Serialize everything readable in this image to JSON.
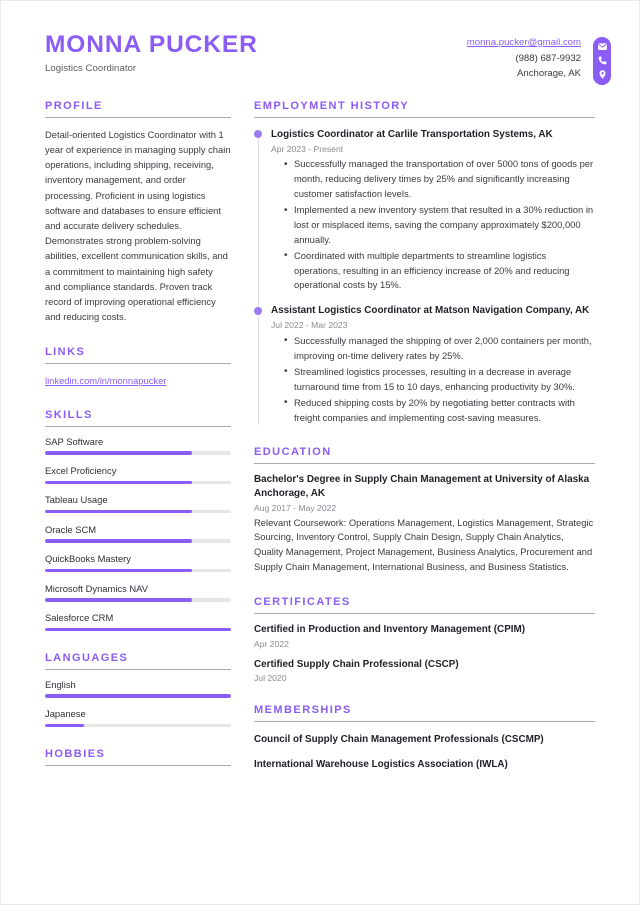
{
  "header": {
    "name": "MONNA PUCKER",
    "job_title": "Logistics Coordinator",
    "email": "monna.pucker@gmail.com",
    "phone": "(988) 687-9932",
    "location": "Anchorage, AK",
    "icons": [
      "envelope-icon",
      "phone-icon",
      "location-pin-icon"
    ]
  },
  "theme": {
    "accent": "#8B5CF6",
    "text": "#3a3a42",
    "muted": "#8a8a93",
    "rule": "#a9a9b0",
    "track": "#e6e6ea"
  },
  "left": {
    "profile": {
      "title": "PROFILE",
      "text": "Detail-oriented Logistics Coordinator with 1 year of experience in managing supply chain operations, including shipping, receiving, inventory management, and order processing. Proficient in using logistics software and databases to ensure efficient and accurate delivery schedules. Demonstrates strong problem-solving abilities, excellent communication skills, and a commitment to maintaining high safety and compliance standards. Proven track record of improving operational efficiency and reducing costs."
    },
    "links": {
      "title": "LINKS",
      "items": [
        {
          "label": "linkedin.com/in/monnapucker"
        }
      ]
    },
    "skills": {
      "title": "SKILLS",
      "items": [
        {
          "label": "SAP Software",
          "level": 79
        },
        {
          "label": "Excel Proficiency",
          "level": 79
        },
        {
          "label": "Tableau Usage",
          "level": 79
        },
        {
          "label": "Oracle SCM",
          "level": 79
        },
        {
          "label": "QuickBooks Mastery",
          "level": 79
        },
        {
          "label": "Microsoft Dynamics NAV",
          "level": 79
        },
        {
          "label": "Salesforce CRM",
          "level": 100
        }
      ]
    },
    "languages": {
      "title": "LANGUAGES",
      "items": [
        {
          "label": "English",
          "level": 100
        },
        {
          "label": "Japanese",
          "level": 21
        }
      ]
    },
    "hobbies": {
      "title": "HOBBIES"
    }
  },
  "right": {
    "employment": {
      "title": "EMPLOYMENT HISTORY",
      "jobs": [
        {
          "heading": "Logistics Coordinator at Carlile Transportation Systems, AK",
          "date": "Apr 2023 - Present",
          "bullets": [
            "Successfully managed the transportation of over 5000 tons of goods per month, reducing delivery times by 25% and significantly increasing customer satisfaction levels.",
            "Implemented a new inventory system that resulted in a 30% reduction in lost or misplaced items, saving the company approximately $200,000 annually.",
            "Coordinated with multiple departments to streamline logistics operations, resulting in an efficiency increase of 20% and reducing operational costs by 15%."
          ]
        },
        {
          "heading": "Assistant Logistics Coordinator at Matson Navigation Company, AK",
          "date": "Jul 2022 - Mar 2023",
          "bullets": [
            "Successfully managed the shipping of over 2,000 containers per month, improving on-time delivery rates by 25%.",
            "Streamlined logistics processes, resulting in a decrease in average turnaround time from 15 to 10 days, enhancing productivity by 30%.",
            "Reduced shipping costs by 20% by negotiating better contracts with freight companies and implementing cost-saving measures."
          ]
        }
      ]
    },
    "education": {
      "title": "EDUCATION",
      "items": [
        {
          "heading": "Bachelor's Degree in Supply Chain Management at University of Alaska Anchorage, AK",
          "date": "Aug 2017 - May 2022",
          "description": "Relevant Coursework: Operations Management, Logistics Management, Strategic Sourcing, Inventory Control, Supply Chain Design, Supply Chain Analytics, Quality Management, Project Management, Business Analytics, Procurement and Supply Chain Management, International Business, and Business Statistics."
        }
      ]
    },
    "certificates": {
      "title": "CERTIFICATES",
      "items": [
        {
          "name": "Certified in Production and Inventory Management (CPIM)",
          "date": "Apr 2022"
        },
        {
          "name": "Certified Supply Chain Professional (CSCP)",
          "date": "Jul 2020"
        }
      ]
    },
    "memberships": {
      "title": "MEMBERSHIPS",
      "items": [
        {
          "name": "Council of Supply Chain Management Professionals (CSCMP)"
        },
        {
          "name": "International Warehouse Logistics Association (IWLA)"
        }
      ]
    }
  }
}
